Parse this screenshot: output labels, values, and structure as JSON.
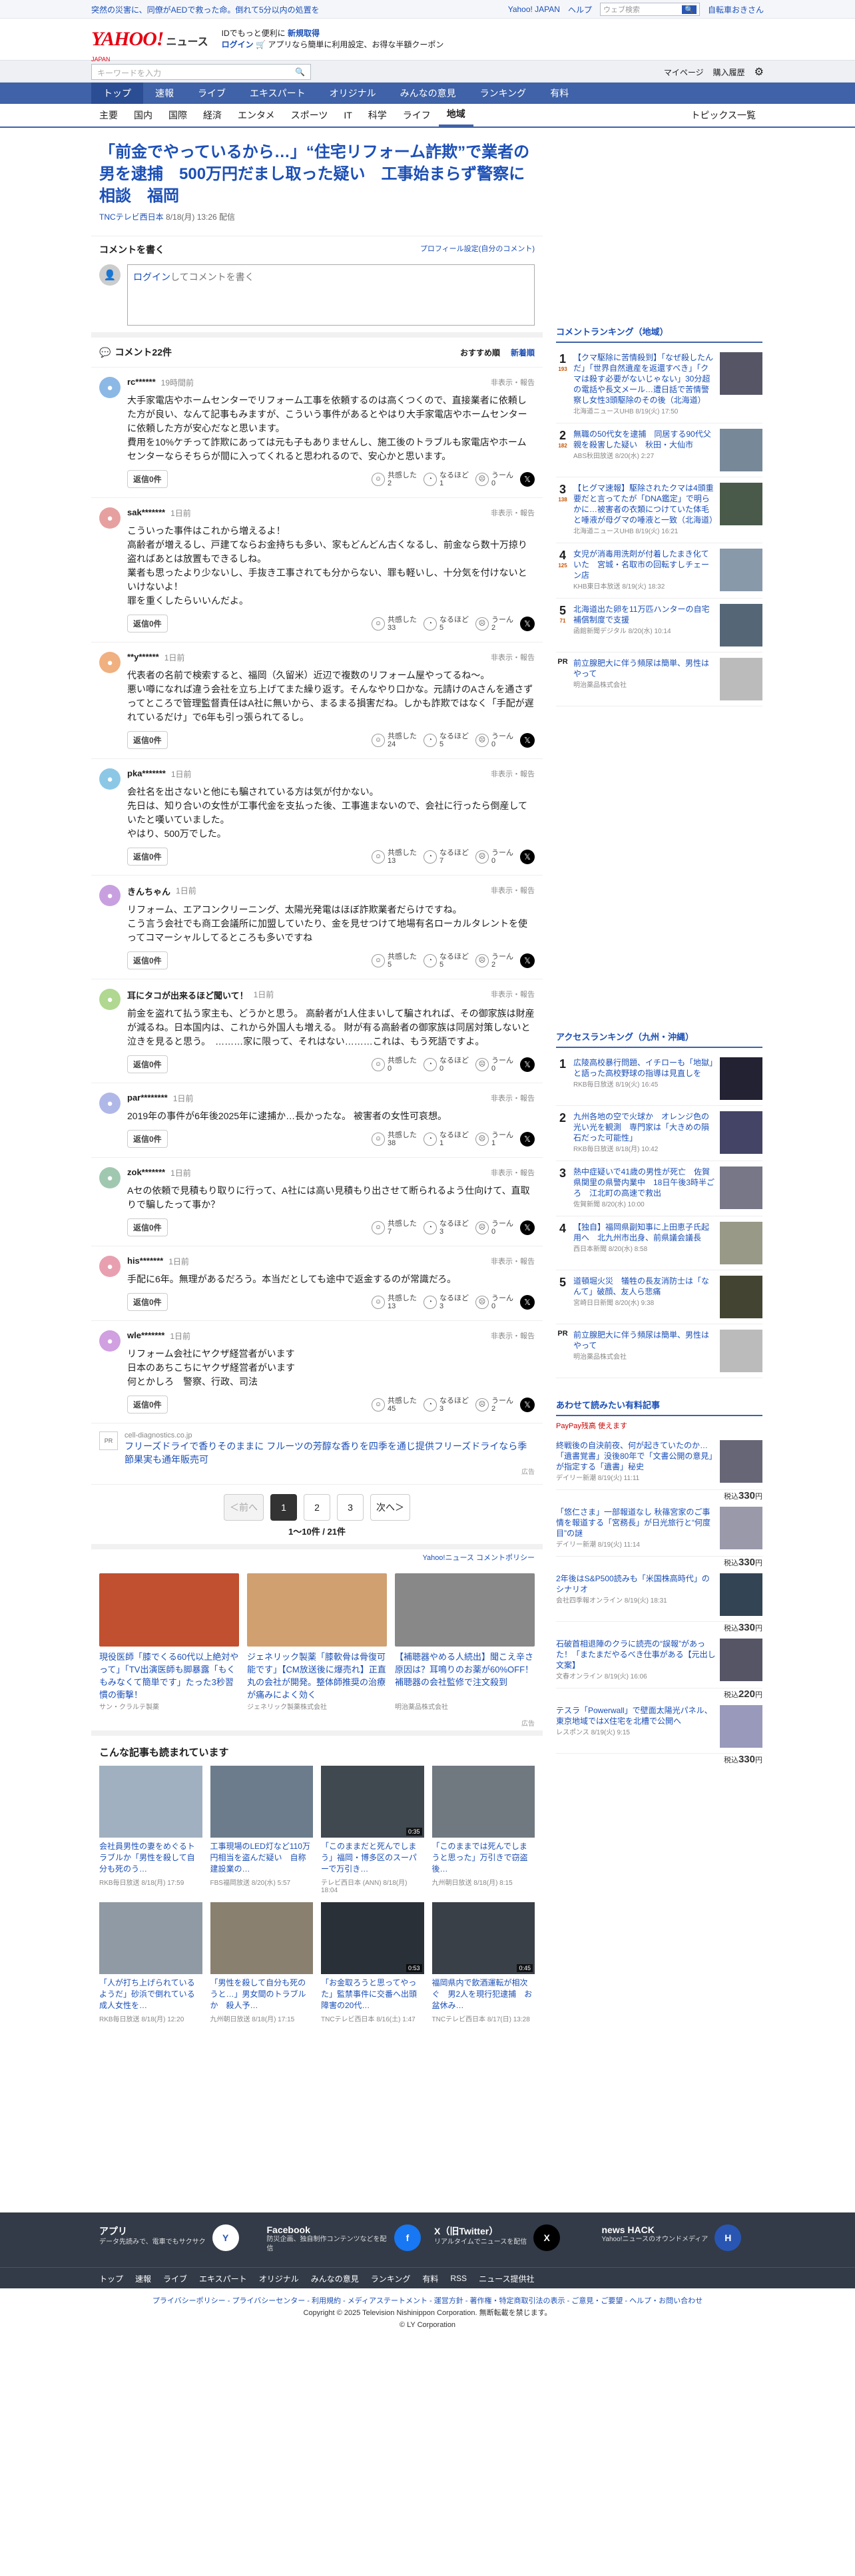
{
  "topbar": {
    "promo": "突然の災害に、同僚がAEDで救った命。倒れて5分以内の処置を",
    "yj": "Yahoo! JAPAN",
    "help": "ヘルプ",
    "search_ph": "ウェブ検索",
    "search_btn": "🔍",
    "user": "自転車おきさん"
  },
  "header": {
    "logo": "YAHOO!",
    "logo_sub": "ニュース",
    "jp": "JAPAN",
    "id_line": "IDでもっと便利に",
    "new_reg": "新規取得",
    "login": "ログイン",
    "app_line": "アプリなら簡単に利用設定、お得な半額クーポン"
  },
  "bar2": {
    "ph": "キーワードを入力",
    "mypage": "マイページ",
    "purchase": "購入履歴"
  },
  "gnav": [
    "トップ",
    "速報",
    "ライブ",
    "エキスパート",
    "オリジナル",
    "みんなの意見",
    "ランキング",
    "有料"
  ],
  "snav": [
    "主要",
    "国内",
    "国際",
    "経済",
    "エンタメ",
    "スポーツ",
    "IT",
    "科学",
    "ライフ",
    "地域"
  ],
  "snav_right": "トピックス一覧",
  "article": {
    "title": "「前金でやっているから…」“住宅リフォーム詐欺”で業者の男を逮捕　500万円だまし取った疑い　工事始まらず警察に相談　福岡",
    "source": "TNCテレビ西日本",
    "date": "8/18(月) 13:26 配信"
  },
  "cbox": {
    "title": "コメントを書く",
    "profile_link": "プロフィール設定(自分のコメント)",
    "login_link": "ログイン",
    "ta_rest": "してコメントを書く"
  },
  "clist": {
    "title": "コメント22件",
    "sort1": "おすすめ順",
    "sort2": "新着順"
  },
  "comments": [
    {
      "user": "rc******",
      "time": "19時間前",
      "text": "大手家電店やホームセンターでリフォーム工事を依頼するのは高くつくので、直接業者に依頼した方が良い、なんて記事もみますが、こういう事件があるとやはり大手家電店やホームセンターに依頼した方が安心だなと思います。\n費用を10%ケチって詐欺にあっては元も子もありませんし、施工後のトラブルも家電店やホームセンターならそちらが間に入ってくれると思われるので、安心かと思います。",
      "r1": "2",
      "r2": "1",
      "r3": "0",
      "c": "#8cb8e6"
    },
    {
      "user": "sak*******",
      "time": "1日前",
      "text": "こういった事件はこれから増えるよ！\n高齢者が増えるし、戸建てならお金持ちも多い、家もどんどん古くなるし、前金なら数十万掠り盗ればあとは放置もできるしね。\n業者も思ったより少ないし、手抜き工事されても分からない、罪も軽いし、十分気を付けないといけないよ！\n罪を重くしたらいいんだよ。",
      "r1": "33",
      "r2": "5",
      "r3": "2",
      "c": "#e6a0a0"
    },
    {
      "user": "**y******",
      "time": "1日前",
      "text": "代表者の名前で検索すると、福岡（久留米）近辺で複数のリフォーム屋やってるね〜。\n悪い噂になれば違う会社を立ち上げてまた繰り返す。そんなやり口かな。元請けのAさんを通さずってところで管理監督責任はA社に無いから、まるまる損害だね。しかも詐欺ではなく「手配が遅れているだけ」で6年も引っ張られてるし。",
      "r1": "24",
      "r2": "5",
      "r3": "0",
      "c": "#f0b080"
    },
    {
      "user": "pka*******",
      "time": "1日前",
      "text": "会社名を出さないと他にも騙されている方は気が付かない。\n先日は、知り合いの女性が工事代金を支払った後、工事進まないので、会社に行ったら倒産していたと嘆いていました。\nやはり、500万でした。",
      "r1": "13",
      "r2": "7",
      "r3": "0",
      "c": "#8cc8e6"
    },
    {
      "user": "きんちゃん",
      "time": "1日前",
      "text": "リフォーム、エアコンクリーニング、太陽光発電はほぼ詐欺業者だらけですね。\nこう言う会社でも商工会議所に加盟していたり、金を見せつけて地場有名ローカルタレントを使ってコマーシャルしてるところも多いですね",
      "r1": "5",
      "r2": "5",
      "r3": "2",
      "c": "#c8a0e0"
    },
    {
      "user": "耳にタコが出来るほど聞いて！",
      "time": "1日前",
      "text": "前金を盗れて払う家主も、どうかと思う。 高齢者が1人住まいして騙されれば、その御家族は財産が減るね。日本国内は、これから外国人も増える。 財が有る高齢者の御家族は同居対策しないと泣きを見ると思う。　………家に限って、それはない………これは、もう死語ですよ。",
      "r1": "0",
      "r2": "0",
      "r3": "0",
      "c": "#b0d890"
    },
    {
      "user": "par********",
      "time": "1日前",
      "text": "2019年の事件が6年後2025年に逮捕か…長かったな。 被害者の女性可哀想。",
      "r1": "38",
      "r2": "1",
      "r3": "1",
      "c": "#b0b8e8"
    },
    {
      "user": "zok*******",
      "time": "1日前",
      "text": "Aセの依頼で見積もり取りに行って、A社には高い見積もり出させて断られるよう仕向けて、直取りで騙したって事か？",
      "r1": "7",
      "r2": "3",
      "r3": "0",
      "c": "#a0c8b0"
    },
    {
      "user": "his*******",
      "time": "1日前",
      "text": "手配に6年。無理があるだろう。本当だとしても途中で返金するのが常識だろ。",
      "r1": "13",
      "r2": "3",
      "r3": "0",
      "c": "#e8a0b0"
    },
    {
      "user": "wle*******",
      "time": "1日前",
      "text": "リフォーム会社にヤクザ経営者がいます\n日本のあちこちにヤクザ経営者がいます\n何とかしろ　警察、行政、司法",
      "r1": "45",
      "r2": "3",
      "r3": "2",
      "c": "#d0a0e0"
    }
  ],
  "labels": {
    "reply": "返信0件",
    "report": "非表示・報告",
    "k1": "共感した",
    "k2": "なるほど",
    "k3": "うーん"
  },
  "pr": {
    "url": "cell-diagnostics.co.jp",
    "title": "フリーズドライで香りそのままに フルーツの芳醇な香りを四季を通じ提供フリーズドライなら季節果実も通年販売可",
    "ad": "広告"
  },
  "pager": {
    "prev": "＜前へ",
    "p1": "1",
    "p2": "2",
    "p3": "3",
    "next": "次へ＞",
    "count": "1〜10件 / 21件"
  },
  "policy": "Yahoo!ニュース コメントポリシー",
  "ads": [
    {
      "t": "現役医師「膝でくる60代以上絶対やって」「TV出演医師も脚暴露「もくもみなくて簡単です」たった3秒習慣の衝撃！",
      "s": "サン・クラルテ製薬",
      "c": "#c05030"
    },
    {
      "t": "ジェネリック製薬「膝軟骨は骨復可能です」【CM放送後に爆売れ】正直丸の会社が開発。整体師推奨の治療が痛みによく効く",
      "s": "ジェネリック製薬株式会社",
      "c": "#d0a070"
    },
    {
      "t": "【補聴器やめる人続出】聞こえ辛さ原因は？耳鳴りのお薬が60%OFF！補聴器の会社監修で注文殺到",
      "s": "明治薬品株式会社",
      "c": "#888"
    }
  ],
  "adflag": "広告",
  "read_head": "こんな記事も読まれています",
  "grid": [
    {
      "t": "会社員男性の妻をめぐるトラブルか「男性を殺して自分も死のう…",
      "s": "RKB毎日放送 8/18(月) 17:59",
      "c": "#a0b0c0",
      "v": ""
    },
    {
      "t": "工事現場のLED灯など110万円相当を盗んだ疑い　自称建設業の…",
      "s": "FBS福岡放送 8/20(水) 5:57",
      "c": "#6c7c8c",
      "v": ""
    },
    {
      "t": "「このままだと死んでしまう」福岡・博多区のスーパーで万引き…",
      "s": "テレビ西日本 (ANN) 8/18(月) 18:04",
      "c": "#404850",
      "v": "0:35"
    },
    {
      "t": "「このままでは死んでしまうと思った」万引きで窃盗後…",
      "s": "九州朝日放送 8/18(月) 8:15",
      "c": "#707880",
      "v": ""
    },
    {
      "t": "「人が打ち上げられているようだ」砂浜で倒れている成人女性を…",
      "s": "RKB毎日放送 8/18(月) 12:20",
      "c": "#909aa4",
      "v": ""
    },
    {
      "t": "「男性を殺して自分も死のうと…」男女間のトラブルか　殺人予…",
      "s": "九州朝日放送 8/18(月) 17:15",
      "c": "#8a8070",
      "v": ""
    },
    {
      "t": "「お金取ろうと思ってやった」監禁事件に交番へ出頭　障害の20代…",
      "s": "TNCテレビ西日本 8/16(土) 1:47",
      "c": "#2a3038",
      "v": "0:53"
    },
    {
      "t": "福岡県内で飲酒運転が相次ぐ　男2人を現行犯逮捕　お盆休み…",
      "s": "TNCテレビ西日本 8/17(日) 13:28",
      "c": "#3a4048",
      "v": "0:45"
    }
  ],
  "side": {
    "r1_head": "コメントランキング（地域）",
    "r1": [
      {
        "t": "【クマ駆除に苦情殺到】「なぜ殺したんだ」「世界自然遺産を返還すべき」「クマは殺す必要がないじゃない」30分超の電話や長文メール…遭日話で苦情警察し女性3頭駆除のその後（北海道）",
        "s": "北海道ニュースUHB 8/19(火) 17:50",
        "k": "1",
        "c": "193",
        "col": "#556"
      },
      {
        "t": "無職の50代女を逮捕　同居する90代父親を殺害した疑い　秋田・大仙市",
        "s": "ABS秋田放送 8/20(水) 2:27",
        "k": "2",
        "c": "182",
        "col": "#789"
      },
      {
        "t": "【ヒグマ速報】駆除されたクマは4頭重要だと言ってたが「DNA鑑定」で明らかに…被害者の衣類につけていた体毛と唾液が母グマの唾液と一致（北海道）",
        "s": "北海道ニュースUHB 8/19(火) 16:21",
        "k": "3",
        "c": "138",
        "col": "#4a5a4a"
      },
      {
        "t": "女児が消毒用洗剤が付着したまき化ていた　宮城・名取市の回転すしチェーン店",
        "s": "KHB東日本放送 8/19(火) 18:32",
        "k": "4",
        "c": "125",
        "col": "#8899aa"
      },
      {
        "t": "北海道出た卵を11万匹ハンターの自宅補償制度で支援",
        "s": "函館新聞デジタル 8/20(水) 10:14",
        "k": "5",
        "c": "71",
        "col": "#556677"
      }
    ],
    "r1_pr": {
      "t": "前立腺肥大に伴う頻尿は簡単、男性はやって",
      "s": "明治薬品株式会社"
    },
    "r2_head": "アクセスランキング（九州・沖縄）",
    "r2": [
      {
        "t": "広陵高校暴行問題、イチローも「地獄」と語った高校野球の指導は見直しを",
        "s": "RKB毎日放送 8/19(火) 16:45",
        "k": "1",
        "col": "#223"
      },
      {
        "t": "九州各地の空で火球か　オレンジ色の光い光を観測　専門家は「大きめの隕石だった可能性」",
        "s": "RKB毎日放送 8/18(月) 10:42",
        "k": "2",
        "col": "#446"
      },
      {
        "t": "熱中症疑いで41歳の男性が死亡　佐賀県関里の県警内業中　18日午後3時半ごろ　江北町の高速で救出",
        "s": "佐賀新聞 8/20(水) 10:00",
        "k": "3",
        "col": "#778"
      },
      {
        "t": "【独自】福岡県副知事に上田恵子氏起用へ　北九州市出身、前県議会議長",
        "s": "西日本新聞 8/20(水) 8:58",
        "k": "4",
        "col": "#998"
      },
      {
        "t": "道頓堀火災　犠牲の長友消防士は「なんて」破顔、友人ら悲痛",
        "s": "宮崎日日新聞 8/20(水) 9:38",
        "k": "5",
        "col": "#443"
      }
    ],
    "r2_pr": {
      "t": "前立腺肥大に伴う頻尿は簡単、男性はやって",
      "s": "明治薬品株式会社"
    },
    "pk_head": "あわせて読みたい有料記事",
    "pk_sub": "PayPay残高 使えます",
    "pk": [
      {
        "t": "終戦後の自決前夜、何が起きていたのか…「遺書覚書」没後80年で「文書公開の意見」が指定する「遺書」秘史",
        "s": "デイリー新潮 8/19(火) 11:11",
        "p": "330",
        "col": "#667"
      },
      {
        "t": "「悠仁さま」一部報道なし 秋篠宮家のご事情を報道する「宮務長」が日光旅行と“何度目”の謎",
        "s": "デイリー新潮 8/19(火) 11:14",
        "p": "330",
        "col": "#99a"
      },
      {
        "t": "2年後はS&P500読みも「米国株高時代」のシナリオ",
        "s": "会社四季報オンライン 8/19(火) 18:31",
        "p": "330",
        "col": "#345"
      },
      {
        "t": "石破首相退陣のクラに読売の“誤報”があった！「またまだやるべき仕事がある【元出し文案】",
        "s": "文春オンライン 8/19(火) 16:06",
        "p": "220",
        "col": "#556"
      },
      {
        "t": "テスラ「Powerwall」で壁面太陽光パネル、東京地域ではX住宅を北槽で公開へ",
        "s": "レスポンス 8/19(火) 9:15",
        "p": "330",
        "col": "#99b"
      }
    ],
    "yen": "円",
    "tax": "税込"
  },
  "footer": [
    {
      "t": "アプリ",
      "d": "データ先読みで、電車でもサクサク",
      "ic": "Y"
    },
    {
      "t": "Facebook",
      "d": "防災企画、独自制作コンテンツなどを配信",
      "ic": "f"
    },
    {
      "t": "X（旧Twitter）",
      "d": "リアルタイムでニュースを配信",
      "ic": "X"
    },
    {
      "t": "news HACK",
      "d": "Yahoo!ニュースのオウンドメディア",
      "ic": "H"
    }
  ],
  "fnav": [
    "トップ",
    "速報",
    "ライブ",
    "エキスパート",
    "オリジナル",
    "みんなの意見",
    "ランキング",
    "有料",
    "RSS",
    "ニュース提供社"
  ],
  "legal": "プライバシーポリシー - プライバシーセンター - 利用規約 - メディアステートメント - 運営方針 - 著作権・特定商取引法の表示 - ご意見・ご要望 - ヘルプ・お問い合わせ",
  "copy": "Copyright © 2025 Television Nishinippon Corporation. 無断転載を禁じます。",
  "copy2": "© LY Corporation"
}
